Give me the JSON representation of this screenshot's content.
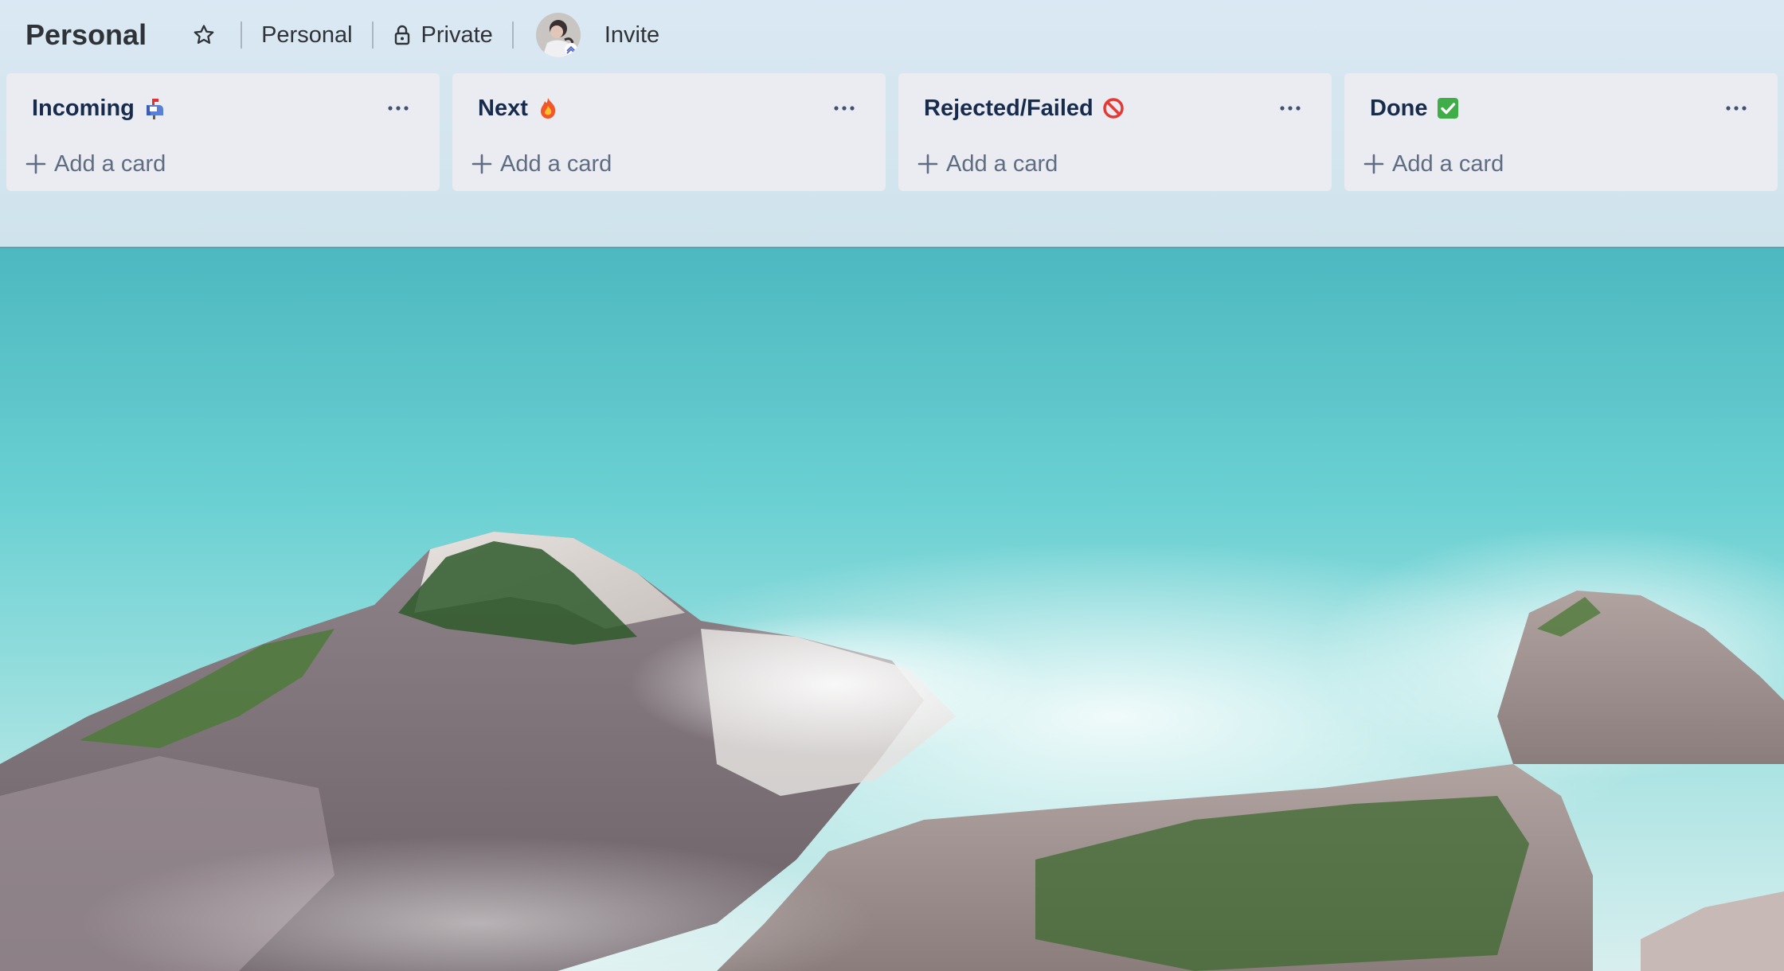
{
  "board": {
    "title": "Personal",
    "workspace": "Personal",
    "visibility": "Private",
    "invite_label": "Invite"
  },
  "lists": [
    {
      "title": "Incoming",
      "emoji": "mailbox-icon",
      "add_label": "Add a card"
    },
    {
      "title": "Next",
      "emoji": "fire-icon",
      "add_label": "Add a card"
    },
    {
      "title": "Rejected/Failed",
      "emoji": "no-entry-icon",
      "add_label": "Add a card"
    },
    {
      "title": "Done",
      "emoji": "check-mark-icon",
      "add_label": "Add a card"
    }
  ],
  "colors": {
    "list_bg": "#ebecf0",
    "title_text": "#172b4d",
    "muted_text": "#5e6c84",
    "sea": "#5fcfcf",
    "sky": "#d8e8f2"
  }
}
